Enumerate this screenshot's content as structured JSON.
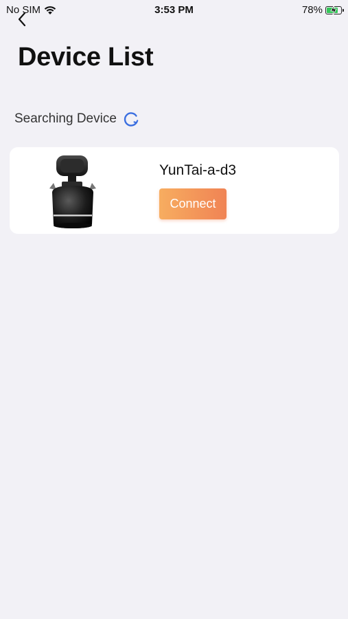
{
  "status_bar": {
    "carrier": "No SIM",
    "time": "3:53 PM",
    "battery_percent": "78%",
    "battery_level": 0.78,
    "charging": true
  },
  "nav": {
    "back_icon": "chevron-left-icon"
  },
  "page": {
    "title": "Device List",
    "searching_label": "Searching Device"
  },
  "devices": [
    {
      "name": "YunTai-a-d3",
      "connect_label": "Connect"
    }
  ],
  "colors": {
    "background": "#f2f1f6",
    "card": "#ffffff",
    "connect_gradient_start": "#f7ad60",
    "connect_gradient_end": "#f08354",
    "spinner": "#3b6fe0",
    "battery_fill": "#34c759"
  }
}
